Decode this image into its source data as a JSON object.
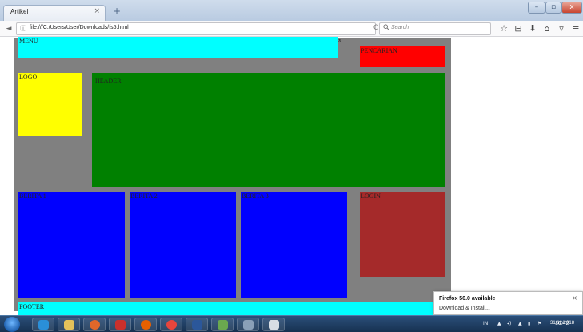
{
  "browser": {
    "tab_title": "Artikel",
    "tab_close": "×",
    "new_tab": "+",
    "window_controls": {
      "minimize": "–",
      "maximize": "▫",
      "close": "x"
    },
    "url": "file:///C:/Users/User/Downloads/fs5.html",
    "search_placeholder": "Search",
    "icons": {
      "back": "◄",
      "info": "ⓘ",
      "reload": "C",
      "search": "🔍",
      "bookmark": "☆",
      "library": "⊟",
      "download": "⬇",
      "home": "⌂",
      "pocket": "▿",
      "menu": "≡"
    }
  },
  "page": {
    "menu": "MENU",
    "menu_mark": "x",
    "pencarian": "PENCARIAN",
    "logo": "LOGO",
    "header": "HEADER",
    "berita1": "BERITA 1",
    "berita2": "BERITA 2",
    "berita3": "BERITA 3",
    "login": "LOGIN",
    "footer": "FOOTER",
    "colors": {
      "wrapper": "#808080",
      "menu": "#00ffff",
      "pencarian": "#ff0000",
      "logo": "#ffff00",
      "header": "#008000",
      "berita": "#0000ff",
      "login": "#a52a2a",
      "footer": "#00ffff"
    }
  },
  "notification": {
    "title": "Firefox 56.0 available",
    "action": "Download & Install...",
    "close": "×"
  },
  "taskbar": {
    "apps": [
      "ie-icon",
      "explorer-icon",
      "media-player-icon",
      "app-icon",
      "firefox-icon",
      "chrome-icon",
      "word-icon",
      "paint-icon",
      "app-icon",
      "folder-icon"
    ],
    "tray": {
      "lang": "IN",
      "time": "16:42",
      "date": "31/12/2018"
    }
  }
}
